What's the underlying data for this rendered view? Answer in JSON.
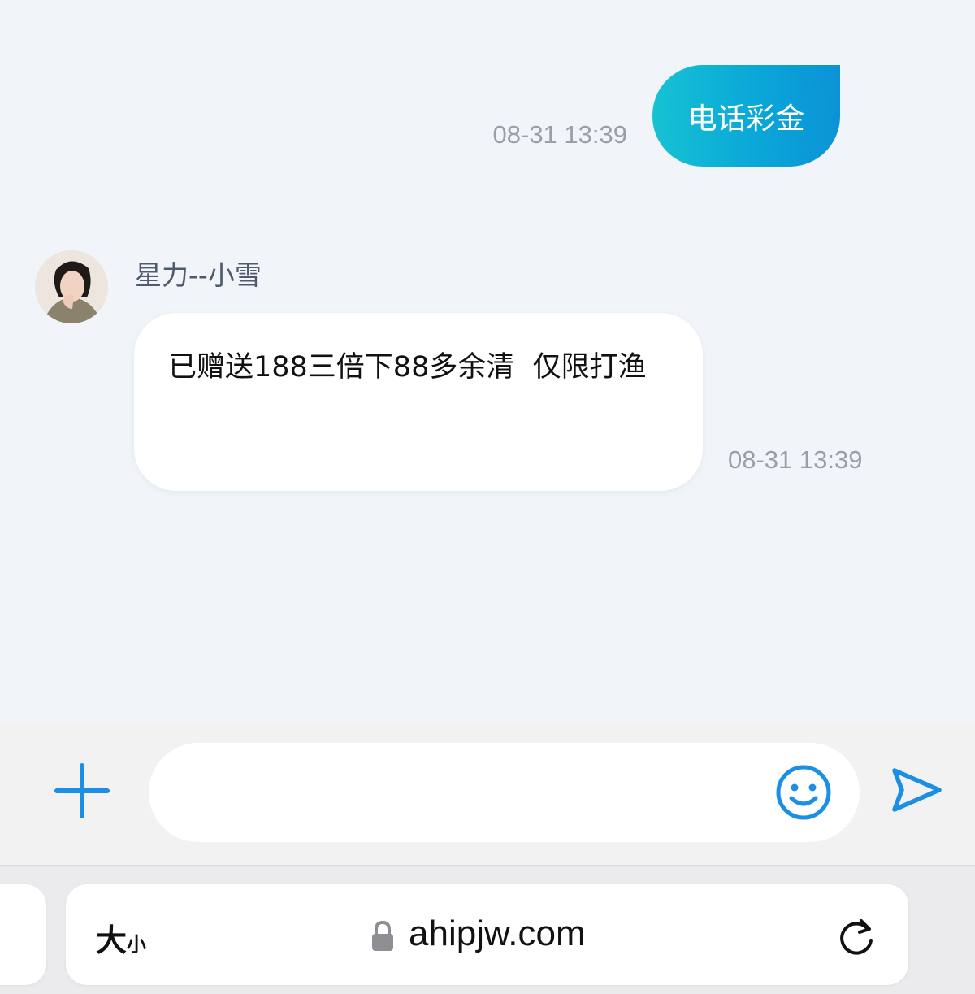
{
  "messages": {
    "outgoing": {
      "text": "电话彩金",
      "time": "08-31 13:39"
    },
    "incoming": {
      "sender": "星力--小雪",
      "text": "已赠送188三倍下88多余清  仅限打渔",
      "time": "08-31 13:39"
    }
  },
  "composer": {
    "input_value": "",
    "icons": [
      "plus-icon",
      "emoji-icon",
      "send-icon"
    ],
    "accent_color": "#1a8fe3"
  },
  "browser": {
    "text_size_big": "大",
    "text_size_small": "小",
    "url": "ahipjw.com",
    "icons": [
      "lock-icon",
      "reload-icon"
    ]
  },
  "colors": {
    "outgoing_bubble": "#0aa7d8",
    "background": "#f1f5f9"
  }
}
